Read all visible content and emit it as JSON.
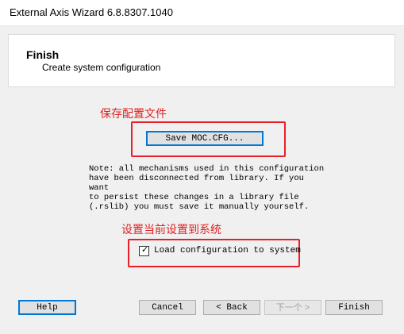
{
  "window": {
    "title": "External Axis Wizard 6.8.8307.1040"
  },
  "header": {
    "title": "Finish",
    "subtitle": "Create system configuration"
  },
  "annotations": {
    "save_note": "保存配置文件",
    "load_note": "设置当前设置到系统",
    "color": "#e02020"
  },
  "save_button_label": "Save MOC.CFG...",
  "note_text": "Note: all mechanisms used in this configuration\nhave been disconnected from library. If you want\nto persist these changes in a library file\n(.rslib) you must save it manually yourself.",
  "load_checkbox": {
    "label": "Load configuration to system",
    "checked": true
  },
  "footer": {
    "help_label": "Help",
    "cancel_label": "Cancel",
    "back_label": "< Back",
    "next_label": "下一个 >",
    "finish_label": "Finish"
  }
}
